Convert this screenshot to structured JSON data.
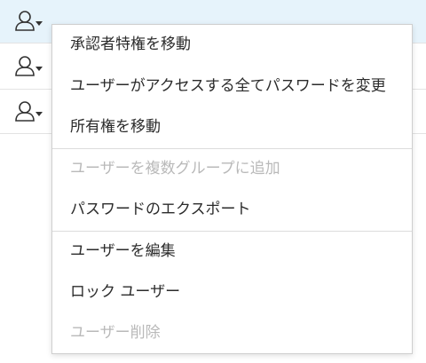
{
  "user_rows": [
    {
      "icon": "user-dropdown-icon",
      "selected": true
    },
    {
      "icon": "user-dropdown-icon",
      "selected": false
    },
    {
      "icon": "user-dropdown-icon",
      "selected": false
    }
  ],
  "context_menu": {
    "items": [
      {
        "label": "承認者特権を移動",
        "enabled": true
      },
      {
        "label": "ユーザーがアクセスする全てパスワードを変更",
        "enabled": true
      },
      {
        "label": "所有権を移動",
        "enabled": true
      },
      {
        "label": "ユーザーを複数グループに追加",
        "enabled": false
      },
      {
        "label": "パスワードのエクスポート",
        "enabled": true
      },
      {
        "label": "ユーザーを編集",
        "enabled": true
      },
      {
        "label": "ロック ユーザー",
        "enabled": true
      },
      {
        "label": "ユーザー削除",
        "enabled": false
      }
    ]
  },
  "colors": {
    "selected_row": "#e6f3fb",
    "text": "#2b2b2b",
    "disabled_text": "#b9b9b9",
    "icon": "#333333"
  }
}
